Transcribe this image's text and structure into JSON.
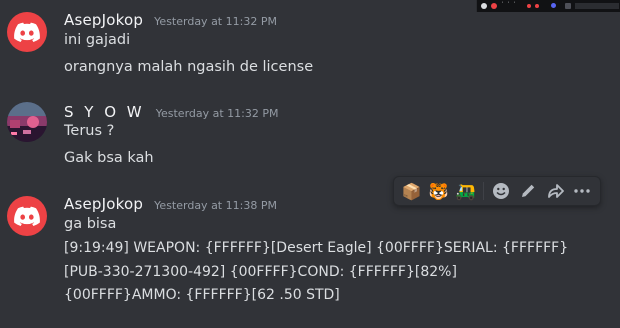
{
  "messages": [
    {
      "username": "AsepJokop",
      "timestamp": "Yesterday at 11:32 PM",
      "lines": [
        "ini gajadi",
        "orangnya malah ngasih de license"
      ]
    },
    {
      "username": "S Y O W",
      "timestamp": "Yesterday at 11:32 PM",
      "lines": [
        "Terus ?",
        "Gak bsa kah"
      ]
    },
    {
      "username": "AsepJokop",
      "timestamp": "Yesterday at 11:38 PM",
      "lines": [
        "ga bisa",
        "[9:19:49] WEAPON: {FFFFFF}[Desert Eagle] {00FFFF}SERIAL: {FFFFFF}",
        "[PUB-330-271300-492] {00FFFF}COND: {FFFFFF}[82%]",
        "{00FFFF}AMMO: {FFFFFF}[62 .50 STD]"
      ]
    }
  ],
  "toolbar": {
    "reactions": [
      "📦",
      "🐯",
      "🛺"
    ],
    "actions": [
      "add-reaction-icon",
      "edit-icon",
      "forward-icon",
      "more-icon"
    ]
  },
  "colors": {
    "background": "#313338",
    "discord_red": "#ed4245",
    "text": "#dbdee1",
    "muted": "#949ba4"
  }
}
